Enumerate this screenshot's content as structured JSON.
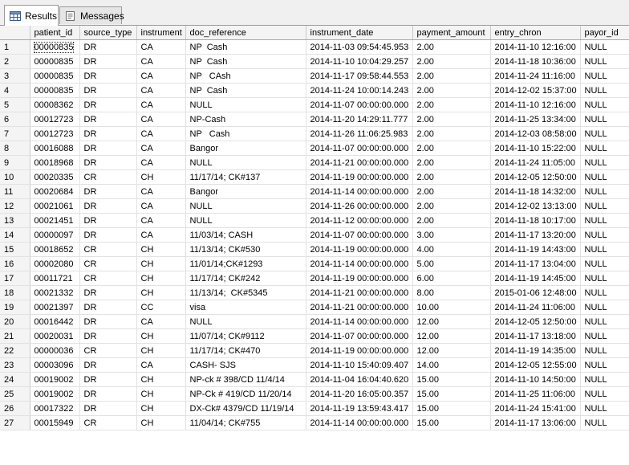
{
  "tabs": [
    {
      "label": "Results",
      "icon": "grid-icon",
      "active": true
    },
    {
      "label": "Messages",
      "icon": "document-icon",
      "active": false
    }
  ],
  "grid": {
    "columns": [
      "patient_id",
      "source_type",
      "instrument",
      "doc_reference",
      "instrument_date",
      "payment_amount",
      "entry_chron",
      "payor_id"
    ],
    "rows": [
      [
        "1",
        "00000835",
        "DR",
        "CA",
        "NP  Cash",
        "2014-11-03 09:54:45.953",
        "2.00",
        "2014-11-10 12:16:00",
        "NULL"
      ],
      [
        "2",
        "00000835",
        "DR",
        "CA",
        "NP  Cash",
        "2014-11-10 10:04:29.257",
        "2.00",
        "2014-11-18 10:36:00",
        "NULL"
      ],
      [
        "3",
        "00000835",
        "DR",
        "CA",
        "NP   CAsh",
        "2014-11-17 09:58:44.553",
        "2.00",
        "2014-11-24 11:16:00",
        "NULL"
      ],
      [
        "4",
        "00000835",
        "DR",
        "CA",
        "NP  Cash",
        "2014-11-24 10:00:14.243",
        "2.00",
        "2014-12-02 15:37:00",
        "NULL"
      ],
      [
        "5",
        "00008362",
        "DR",
        "CA",
        "NULL",
        "2014-11-07 00:00:00.000",
        "2.00",
        "2014-11-10 12:16:00",
        "NULL"
      ],
      [
        "6",
        "00012723",
        "DR",
        "CA",
        "NP-Cash",
        "2014-11-20 14:29:11.777",
        "2.00",
        "2014-11-25 13:34:00",
        "NULL"
      ],
      [
        "7",
        "00012723",
        "DR",
        "CA",
        "NP   Cash",
        "2014-11-26 11:06:25.983",
        "2.00",
        "2014-12-03 08:58:00",
        "NULL"
      ],
      [
        "8",
        "00016088",
        "DR",
        "CA",
        "Bangor",
        "2014-11-07 00:00:00.000",
        "2.00",
        "2014-11-10 15:22:00",
        "NULL"
      ],
      [
        "9",
        "00018968",
        "DR",
        "CA",
        "NULL",
        "2014-11-21 00:00:00.000",
        "2.00",
        "2014-11-24 11:05:00",
        "NULL"
      ],
      [
        "10",
        "00020335",
        "CR",
        "CH",
        "11/17/14; CK#137",
        "2014-11-19 00:00:00.000",
        "2.00",
        "2014-12-05 12:50:00",
        "NULL"
      ],
      [
        "11",
        "00020684",
        "DR",
        "CA",
        "Bangor",
        "2014-11-14 00:00:00.000",
        "2.00",
        "2014-11-18 14:32:00",
        "NULL"
      ],
      [
        "12",
        "00021061",
        "DR",
        "CA",
        "NULL",
        "2014-11-26 00:00:00.000",
        "2.00",
        "2014-12-02 13:13:00",
        "NULL"
      ],
      [
        "13",
        "00021451",
        "DR",
        "CA",
        "NULL",
        "2014-11-12 00:00:00.000",
        "2.00",
        "2014-11-18 10:17:00",
        "NULL"
      ],
      [
        "14",
        "00000097",
        "DR",
        "CA",
        "11/03/14; CASH",
        "2014-11-07 00:00:00.000",
        "3.00",
        "2014-11-17 13:20:00",
        "NULL"
      ],
      [
        "15",
        "00018652",
        "CR",
        "CH",
        "11/13/14; CK#530",
        "2014-11-19 00:00:00.000",
        "4.00",
        "2014-11-19 14:43:00",
        "NULL"
      ],
      [
        "16",
        "00002080",
        "CR",
        "CH",
        "11/01/14;CK#1293",
        "2014-11-14 00:00:00.000",
        "5.00",
        "2014-11-17 13:04:00",
        "NULL"
      ],
      [
        "17",
        "00011721",
        "CR",
        "CH",
        "11/17/14; CK#242",
        "2014-11-19 00:00:00.000",
        "6.00",
        "2014-11-19 14:45:00",
        "NULL"
      ],
      [
        "18",
        "00021332",
        "DR",
        "CH",
        "11/13/14;  CK#5345",
        "2014-11-21 00:00:00.000",
        "8.00",
        "2015-01-06 12:48:00",
        "NULL"
      ],
      [
        "19",
        "00021397",
        "DR",
        "CC",
        "visa",
        "2014-11-21 00:00:00.000",
        "10.00",
        "2014-11-24 11:06:00",
        "NULL"
      ],
      [
        "20",
        "00016442",
        "DR",
        "CA",
        "NULL",
        "2014-11-14 00:00:00.000",
        "12.00",
        "2014-12-05 12:50:00",
        "NULL"
      ],
      [
        "21",
        "00020031",
        "DR",
        "CH",
        "11/07/14; CK#9112",
        "2014-11-07 00:00:00.000",
        "12.00",
        "2014-11-17 13:18:00",
        "NULL"
      ],
      [
        "22",
        "00000036",
        "CR",
        "CH",
        "11/17/14; CK#470",
        "2014-11-19 00:00:00.000",
        "12.00",
        "2014-11-19 14:35:00",
        "NULL"
      ],
      [
        "23",
        "00003096",
        "DR",
        "CA",
        "CASH- SJS",
        "2014-11-10 15:40:09.407",
        "14.00",
        "2014-12-05 12:55:00",
        "NULL"
      ],
      [
        "24",
        "00019002",
        "DR",
        "CH",
        "NP-ck # 398/CD 11/4/14",
        "2014-11-04 16:04:40.620",
        "15.00",
        "2014-11-10 14:50:00",
        "NULL"
      ],
      [
        "25",
        "00019002",
        "DR",
        "CH",
        "NP-Ck # 419/CD 11/20/14",
        "2014-11-20 16:05:00.357",
        "15.00",
        "2014-11-25 11:06:00",
        "NULL"
      ],
      [
        "26",
        "00017322",
        "DR",
        "CH",
        "DX-Ck# 4379/CD 11/19/14",
        "2014-11-19 13:59:43.417",
        "15.00",
        "2014-11-24 15:41:00",
        "NULL"
      ],
      [
        "27",
        "00015949",
        "CR",
        "CH",
        "11/04/14; CK#755",
        "2014-11-14 00:00:00.000",
        "15.00",
        "2014-11-17 13:06:00",
        "NULL"
      ]
    ]
  }
}
